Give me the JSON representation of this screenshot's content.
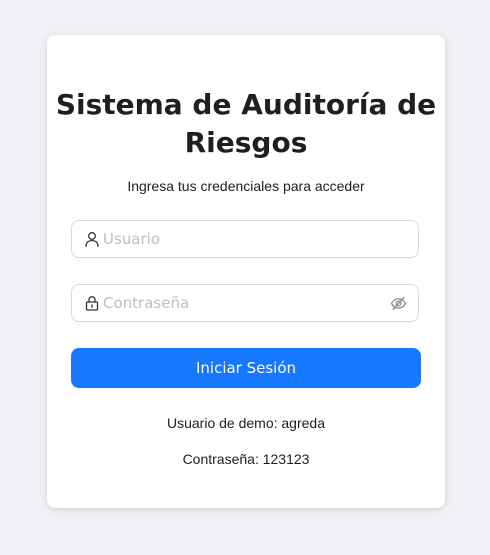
{
  "login": {
    "title": "Sistema de Auditoría de Riesgos",
    "subtitle": "Ingresa tus credenciales para acceder",
    "username": {
      "placeholder": "Usuario",
      "value": "",
      "icon": "user-icon"
    },
    "password": {
      "placeholder": "Contraseña",
      "value": "",
      "icon": "lock-icon",
      "toggle_icon": "eye-invisible-icon"
    },
    "submit_label": "Iniciar Sesión",
    "demo_user": "Usuario de demo: agreda",
    "demo_password": "Contraseña: 123123"
  },
  "colors": {
    "background": "#f0f2f5",
    "card": "#ffffff",
    "primary": "#1677ff",
    "border": "#d9d9d9",
    "placeholder": "#bfbfbf"
  }
}
